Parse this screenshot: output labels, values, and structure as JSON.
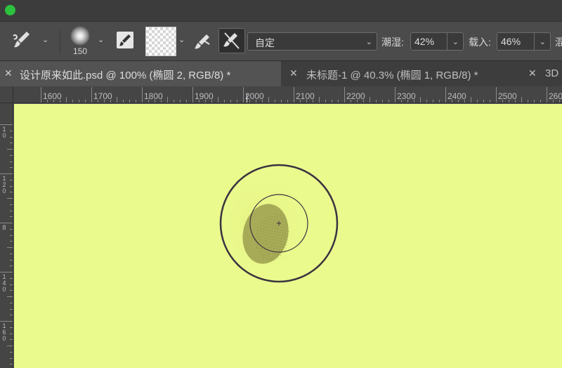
{
  "titlebar": {
    "traffic_light_color": "#2cc23e"
  },
  "options_bar": {
    "tool_icon": "mixer-brush-icon",
    "brush_size": "150",
    "mode_icon": "brush-mode-icon",
    "load_icon": "load-brush-icon",
    "clean_icon": "clean-brush-icon",
    "preset": {
      "value": "自定"
    },
    "wet": {
      "label": "潮湿:",
      "value": "42%"
    },
    "load": {
      "label": "载入:",
      "value": "46%"
    },
    "mix": {
      "label": "混"
    }
  },
  "tabs": [
    {
      "label": "设计原来如此.psd @ 100% (椭圆 2, RGB/8) *",
      "active": true
    },
    {
      "label": "未标题-1 @ 40.3% (椭圆 1, RGB/8) *",
      "active": false
    },
    {
      "label": "3D",
      "active": false
    }
  ],
  "ruler": {
    "top_labels": [
      "1600",
      "1700",
      "1800",
      "1900",
      "2000",
      "2100",
      "2200",
      "2300",
      "2400",
      "2500",
      "260"
    ],
    "left_labels": [
      "1\n0",
      "1\n2\n0",
      "8",
      "1\n4\n0",
      "1\n6\n0"
    ]
  },
  "canvas": {
    "background": "#ebfa8d",
    "paint_color": "#a7ab57",
    "cursor_color": "#3a3340"
  }
}
